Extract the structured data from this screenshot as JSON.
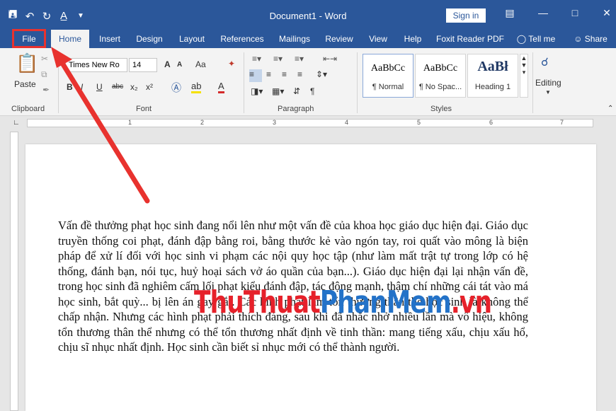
{
  "window": {
    "title": "Document1 - Word",
    "sign_in": "Sign in",
    "qat": {
      "save_icon": "save-icon",
      "undo_icon": "undo-icon",
      "redo_icon": "redo-icon",
      "format_icon": "format-painter-icon"
    }
  },
  "tabs": [
    "File",
    "Home",
    "Insert",
    "Design",
    "Layout",
    "References",
    "Mailings",
    "Review",
    "View",
    "Help",
    "Foxit Reader PDF",
    "Tell me",
    "Share"
  ],
  "active_tab": "Home",
  "ribbon": {
    "clipboard": {
      "label": "Clipboard",
      "paste": "Paste"
    },
    "font": {
      "label": "Font",
      "font_name": "Times New Ro",
      "font_size": "14",
      "bold": "B",
      "italic": "I",
      "underline": "U",
      "strike": "abc",
      "subscript": "x₂",
      "superscript": "x²",
      "change_case": "Aa",
      "grow": "A",
      "shrink": "A"
    },
    "paragraph": {
      "label": "Paragraph"
    },
    "styles": {
      "label": "Styles",
      "items": [
        {
          "sample": "AaBbCc",
          "name": "¶ Normal"
        },
        {
          "sample": "AaBbCc",
          "name": "¶ No Spac..."
        },
        {
          "sample": "AaBł",
          "name": "Heading 1"
        }
      ]
    },
    "editing": {
      "label": "Editing"
    }
  },
  "ruler": {
    "numbers": [
      "1",
      "2",
      "3",
      "4",
      "5",
      "6",
      "7"
    ]
  },
  "document": {
    "paragraph": "Vấn đề thưởng phạt học sinh đang nổi lên như một vấn đề của khoa học giáo dục hiện đại. Giáo dục truyền thống coi phạt, đánh đập bằng roi, bằng thước kẻ vào ngón tay, roi quất vào mông là biện pháp để xử lí đối với học sinh vi phạm các nội quy học tập (như làm mất trật tự trong lớp có hệ thống, đánh bạn, nói tục, huỷ hoại sách vở áo quần của bạn...). Giáo dục hiện đại lại nhận vấn đề, trong học sinh đã nghiêm cấm lối phạt kiểu đánh đập, tác động mạnh, thậm chí những cái tát vào má học sinh, bắt quỳ... bị lên án gay gắt. Các hình phạt làm tổn thương thân thể học sinh là không thể chấp nhận. Nhưng các hình phạt phải thích đáng, sau khi đã nhắc nhở nhiều lần mà vô hiệu, không tổn thương thân thể nhưng có thể tổn thương nhất định về tinh thần: mang tiếng xấu, chịu xấu hổ, chịu sĩ nhục nhất định. Học sinh cần biết sỉ nhục mới có thể thành người."
  },
  "watermark": {
    "part1": "ThuThuat",
    "part2": "PhanMem",
    "part3": ".vn"
  },
  "colors": {
    "title_bar": "#2b579a",
    "highlight_box": "#e8322e",
    "arrow": "#e8322e"
  }
}
